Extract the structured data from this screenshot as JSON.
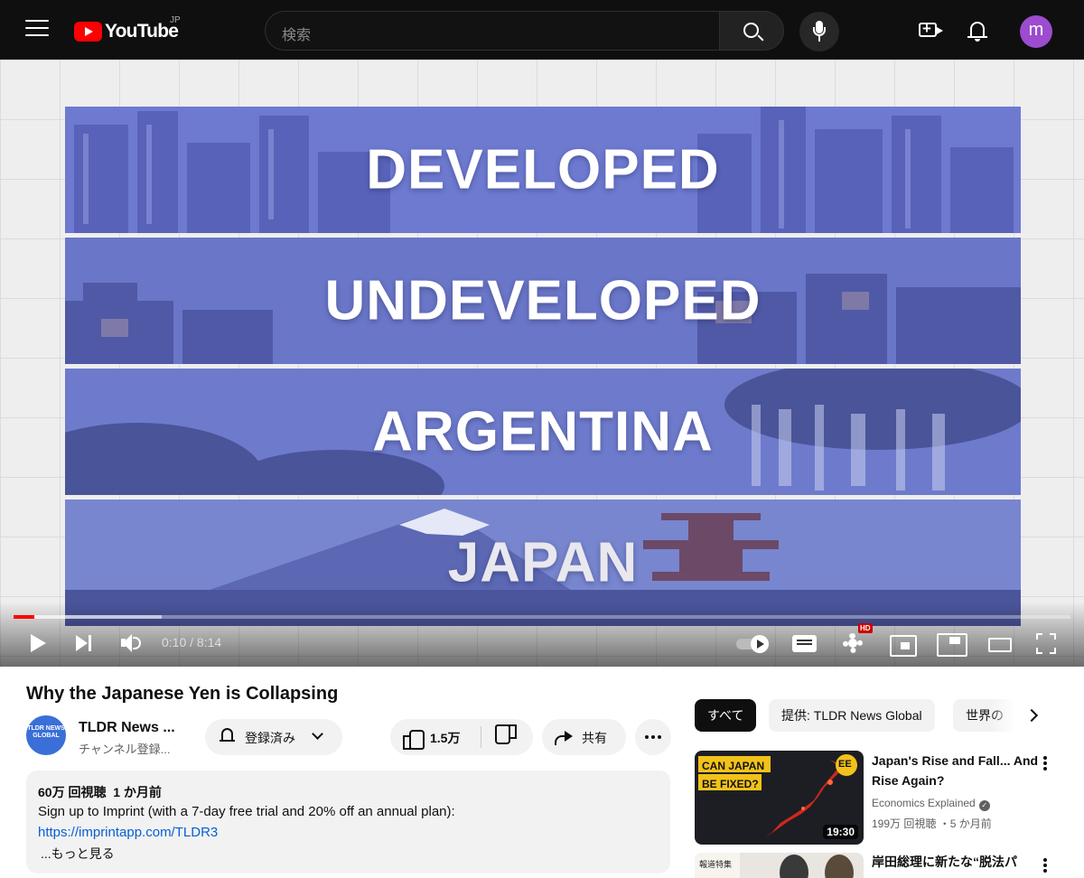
{
  "header": {
    "logo_text": "YouTube",
    "country_code": "JP",
    "search_placeholder": "検索",
    "avatar_letter": "m"
  },
  "player": {
    "slides": [
      "DEVELOPED",
      "UNDEVELOPED",
      "ARGENTINA",
      "JAPAN"
    ],
    "time_display": "0:10 / 8:14",
    "played_fraction": 0.02,
    "buffered_fraction": 0.14,
    "hd_badge": "HD"
  },
  "video": {
    "title": "Why the Japanese Yen is Collapsing",
    "channel_name": "TLDR News ...",
    "channel_avatar_text": "TLDR NEWS GLOBAL",
    "channel_subs": "チャンネル登録...",
    "subscribe_label": "登録済み",
    "like_count": "1.5万",
    "share_label": "共有"
  },
  "description": {
    "views": "60万 回視聴",
    "age": "1 か月前",
    "line1": "Sign up to Imprint (with a 7-day free trial and 20% off an annual plan):",
    "link": "https://imprintapp.com/TLDR3",
    "more": "...もっと見る"
  },
  "sidebar": {
    "chips": [
      "すべて",
      "提供: TLDR News Global",
      "世界の"
    ],
    "recommendations": [
      {
        "title": "Japan's Rise and Fall... And Rise Again?",
        "channel": "Economics Explained",
        "meta": "199万 回視聴 ・5 か月前",
        "duration": "19:30",
        "thumb_text": "CAN JAPAN BE FIXED?",
        "thumb_badge": "EE"
      },
      {
        "title": "岸田総理に新たな“脱法パ",
        "thumb_text": "報道特集"
      }
    ]
  },
  "colors": {
    "brand_red": "#ff0000",
    "link_blue": "#065fd4",
    "slide_tint": "#5a67c4"
  }
}
